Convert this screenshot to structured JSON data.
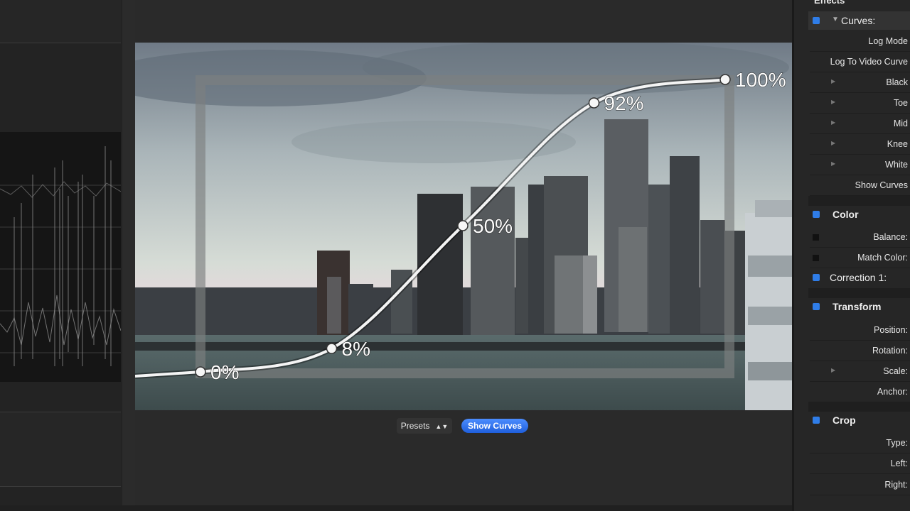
{
  "inspector": {
    "header": "Effects",
    "curves": {
      "title": "Curves:",
      "rows": [
        "Log Mode",
        "Log To Video Curve",
        "Black",
        "Toe",
        "Mid",
        "Knee",
        "White",
        "Show Curves"
      ]
    },
    "color": {
      "title": "Color",
      "rows": [
        "Balance:",
        "Match Color:"
      ]
    },
    "correction": "Correction 1:",
    "transform": {
      "title": "Transform",
      "rows": [
        "Position:",
        "Rotation:",
        "Scale:",
        "Anchor:"
      ]
    },
    "crop": {
      "title": "Crop",
      "rows": [
        "Type:",
        "Left:",
        "Right:"
      ]
    }
  },
  "viewer": {
    "curve_points": [
      {
        "label": "0%",
        "input": 0.0,
        "output": 0.0
      },
      {
        "label": "8%",
        "input": 0.25,
        "output": 0.08
      },
      {
        "label": "50%",
        "input": 0.5,
        "output": 0.5
      },
      {
        "label": "92%",
        "input": 0.75,
        "output": 0.92
      },
      {
        "label": "100%",
        "input": 1.0,
        "output": 1.0
      }
    ],
    "presets_label": "Presets",
    "show_curves_label": "Show Curves"
  },
  "colors": {
    "accent_blue": "#2f7de8",
    "button_blue": "#3a78f0",
    "panel": "#262626"
  }
}
